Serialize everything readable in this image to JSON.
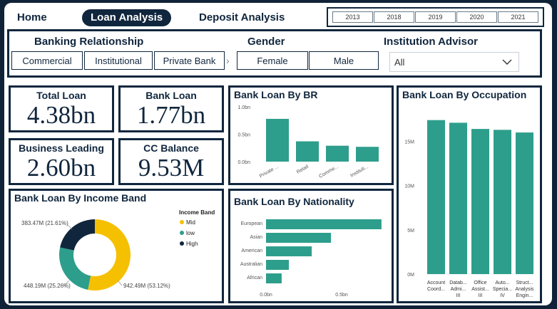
{
  "nav": {
    "home": "Home",
    "loan_analysis": "Loan Analysis",
    "deposit_analysis": "Deposit Analysis"
  },
  "years": [
    "2013",
    "2018",
    "2019",
    "2020",
    "2021"
  ],
  "filters": {
    "banking_relationship": {
      "title": "Banking Relationship",
      "options": [
        "Commercial",
        "Institutional",
        "Private Bank"
      ]
    },
    "gender": {
      "title": "Gender",
      "options": [
        "Female",
        "Male"
      ]
    },
    "institution_advisor": {
      "title": "Institution Advisor",
      "value": "All"
    }
  },
  "kpis": {
    "total_loan": {
      "title": "Total Loan",
      "value": "4.38bn"
    },
    "bank_loan": {
      "title": "Bank Loan",
      "value": "1.77bn"
    },
    "business_leading": {
      "title": "Business Leading",
      "value": "2.60bn"
    },
    "cc_balance": {
      "title": "CC Balance",
      "value": "9.53M"
    }
  },
  "colors": {
    "navy": "#10263d",
    "teal": "#2e9e8c",
    "gold": "#f5c000",
    "background": "#0f2238"
  },
  "chart_data": [
    {
      "type": "bar",
      "title": "Bank Loan By BR",
      "categories": [
        "Private ...",
        "Retail",
        "Comme...",
        "Instituti..."
      ],
      "values": [
        0.78,
        0.37,
        0.29,
        0.27
      ],
      "yticks": [
        "0.0bn",
        "0.5bn",
        "1.0bn"
      ],
      "ylim": [
        0,
        1.0
      ]
    },
    {
      "type": "bar",
      "title": "Bank Loan By Occupation",
      "categories": [
        [
          "Account",
          "Coord..."
        ],
        [
          "Datab...",
          "Admi...",
          "III"
        ],
        [
          "Office",
          "Assist...",
          "III"
        ],
        [
          "Auto...",
          "Specia...",
          "IV"
        ],
        [
          "Struct...",
          "Analysis",
          "Engin..."
        ]
      ],
      "values": [
        17.4,
        17.1,
        16.4,
        16.3,
        16.0
      ],
      "yticks": [
        "0M",
        "5M",
        "10M",
        "15M"
      ],
      "ylim": [
        0,
        18.5
      ]
    },
    {
      "type": "pie",
      "title": "Bank Loan By Income Band",
      "legend_title": "Income Band",
      "slices": [
        {
          "name": "Mid",
          "value": 942.49,
          "label": "942.49M (53.12%)",
          "color": "#f5c000"
        },
        {
          "name": "low",
          "value": 448.19,
          "label": "448.19M (25.26%)",
          "color": "#2e9e8c"
        },
        {
          "name": "High",
          "value": 383.47,
          "label": "383.47M (21.61%)",
          "color": "#10263d"
        }
      ]
    },
    {
      "type": "bar",
      "orientation": "horizontal",
      "title": "Bank Loan By Nationality",
      "categories": [
        "European",
        "Asian",
        "American",
        "Australian",
        "African"
      ],
      "values": [
        0.96,
        0.54,
        0.38,
        0.19,
        0.13
      ],
      "xticks": [
        "0.0bn",
        "0.5bn"
      ],
      "xlim": [
        0,
        1.0
      ]
    }
  ]
}
